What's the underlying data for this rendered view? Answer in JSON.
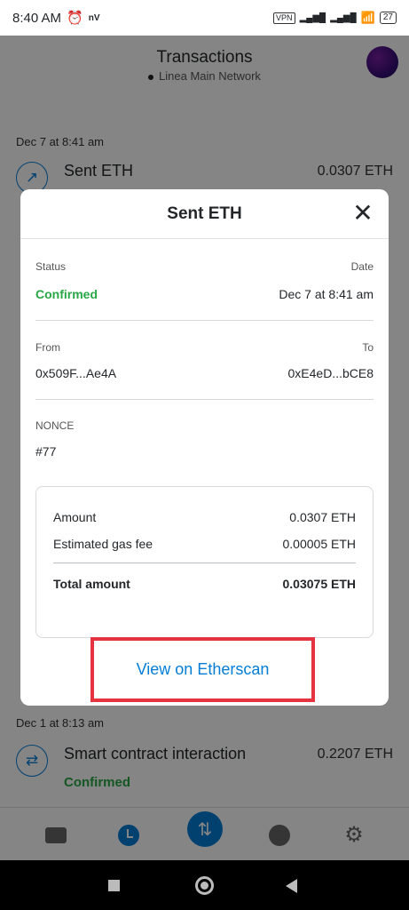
{
  "status_bar": {
    "time": "8:40 AM",
    "carrier_badge": "nV",
    "vpn": "VPN",
    "battery": "27"
  },
  "header": {
    "title": "Transactions",
    "network": "Linea Main Network"
  },
  "transactions": [
    {
      "date": "Dec 7 at 8:41 am",
      "label": "Sent ETH",
      "amount": "0.0307 ETH",
      "icon": "arrow-up-right-icon"
    },
    {
      "date": "Dec 1 at 8:13 am",
      "label": "Smart contract interaction",
      "amount": "0.2207 ETH",
      "status": "Confirmed",
      "icon": "swap-arrows-icon"
    }
  ],
  "modal": {
    "title": "Sent ETH",
    "status_label": "Status",
    "status_value": "Confirmed",
    "date_label": "Date",
    "date_value": "Dec 7 at 8:41 am",
    "from_label": "From",
    "from_value": "0x509F...Ae4A",
    "to_label": "To",
    "to_value": "0xE4eD...bCE8",
    "nonce_label": "NONCE",
    "nonce_value": "#77",
    "summary": {
      "amount_label": "Amount",
      "amount_value": "0.0307 ETH",
      "gas_label": "Estimated gas fee",
      "gas_value": "0.00005 ETH",
      "total_label": "Total amount",
      "total_value": "0.03075 ETH"
    },
    "link_label": "View on Etherscan"
  },
  "colors": {
    "accent": "#037dd6",
    "confirmed": "#28a745",
    "highlight": "#e5333f"
  }
}
